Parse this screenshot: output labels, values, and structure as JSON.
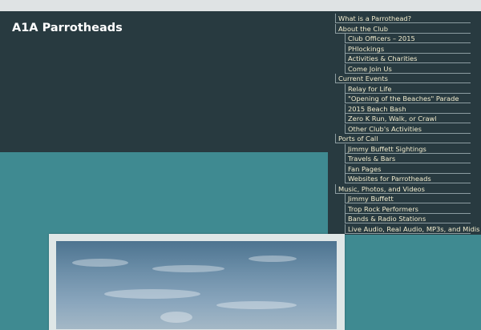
{
  "site": {
    "title": "A1A Parrotheads"
  },
  "nav": {
    "items": [
      {
        "label": "What is a Parrothead?",
        "level": 0
      },
      {
        "label": "About the Club",
        "level": 0
      },
      {
        "label": "Club Officers – 2015",
        "level": 1
      },
      {
        "label": "PHlockings",
        "level": 1
      },
      {
        "label": "Activities & Charities",
        "level": 1
      },
      {
        "label": "Come Join Us",
        "level": 1
      },
      {
        "label": "Current Events",
        "level": 0
      },
      {
        "label": "Relay for Life",
        "level": 1
      },
      {
        "label": "\"Opening of the Beaches\" Parade",
        "level": 1
      },
      {
        "label": "2015 Beach Bash",
        "level": 1
      },
      {
        "label": "Zero K Run, Walk, or Crawl",
        "level": 1
      },
      {
        "label": "Other Club's Activities",
        "level": 1
      },
      {
        "label": "Ports of Call",
        "level": 0
      },
      {
        "label": "Jimmy Buffett Sightings",
        "level": 1
      },
      {
        "label": "Travels & Bars",
        "level": 1
      },
      {
        "label": "Fan Pages",
        "level": 1
      },
      {
        "label": "Websites for Parrotheads",
        "level": 1
      },
      {
        "label": "Music, Photos, and Videos",
        "level": 0
      },
      {
        "label": "Jimmy Buffett",
        "level": 1
      },
      {
        "label": "Trop Rock Performers",
        "level": 1
      },
      {
        "label": "Bands & Radio Stations",
        "level": 1
      },
      {
        "label": "Live Audio, Real Audio, MP3s, and Midis",
        "level": 1
      }
    ]
  },
  "colors": {
    "header_bg": "#283a40",
    "page_bg": "#3f8a91",
    "menu_text": "#f2eccd"
  }
}
